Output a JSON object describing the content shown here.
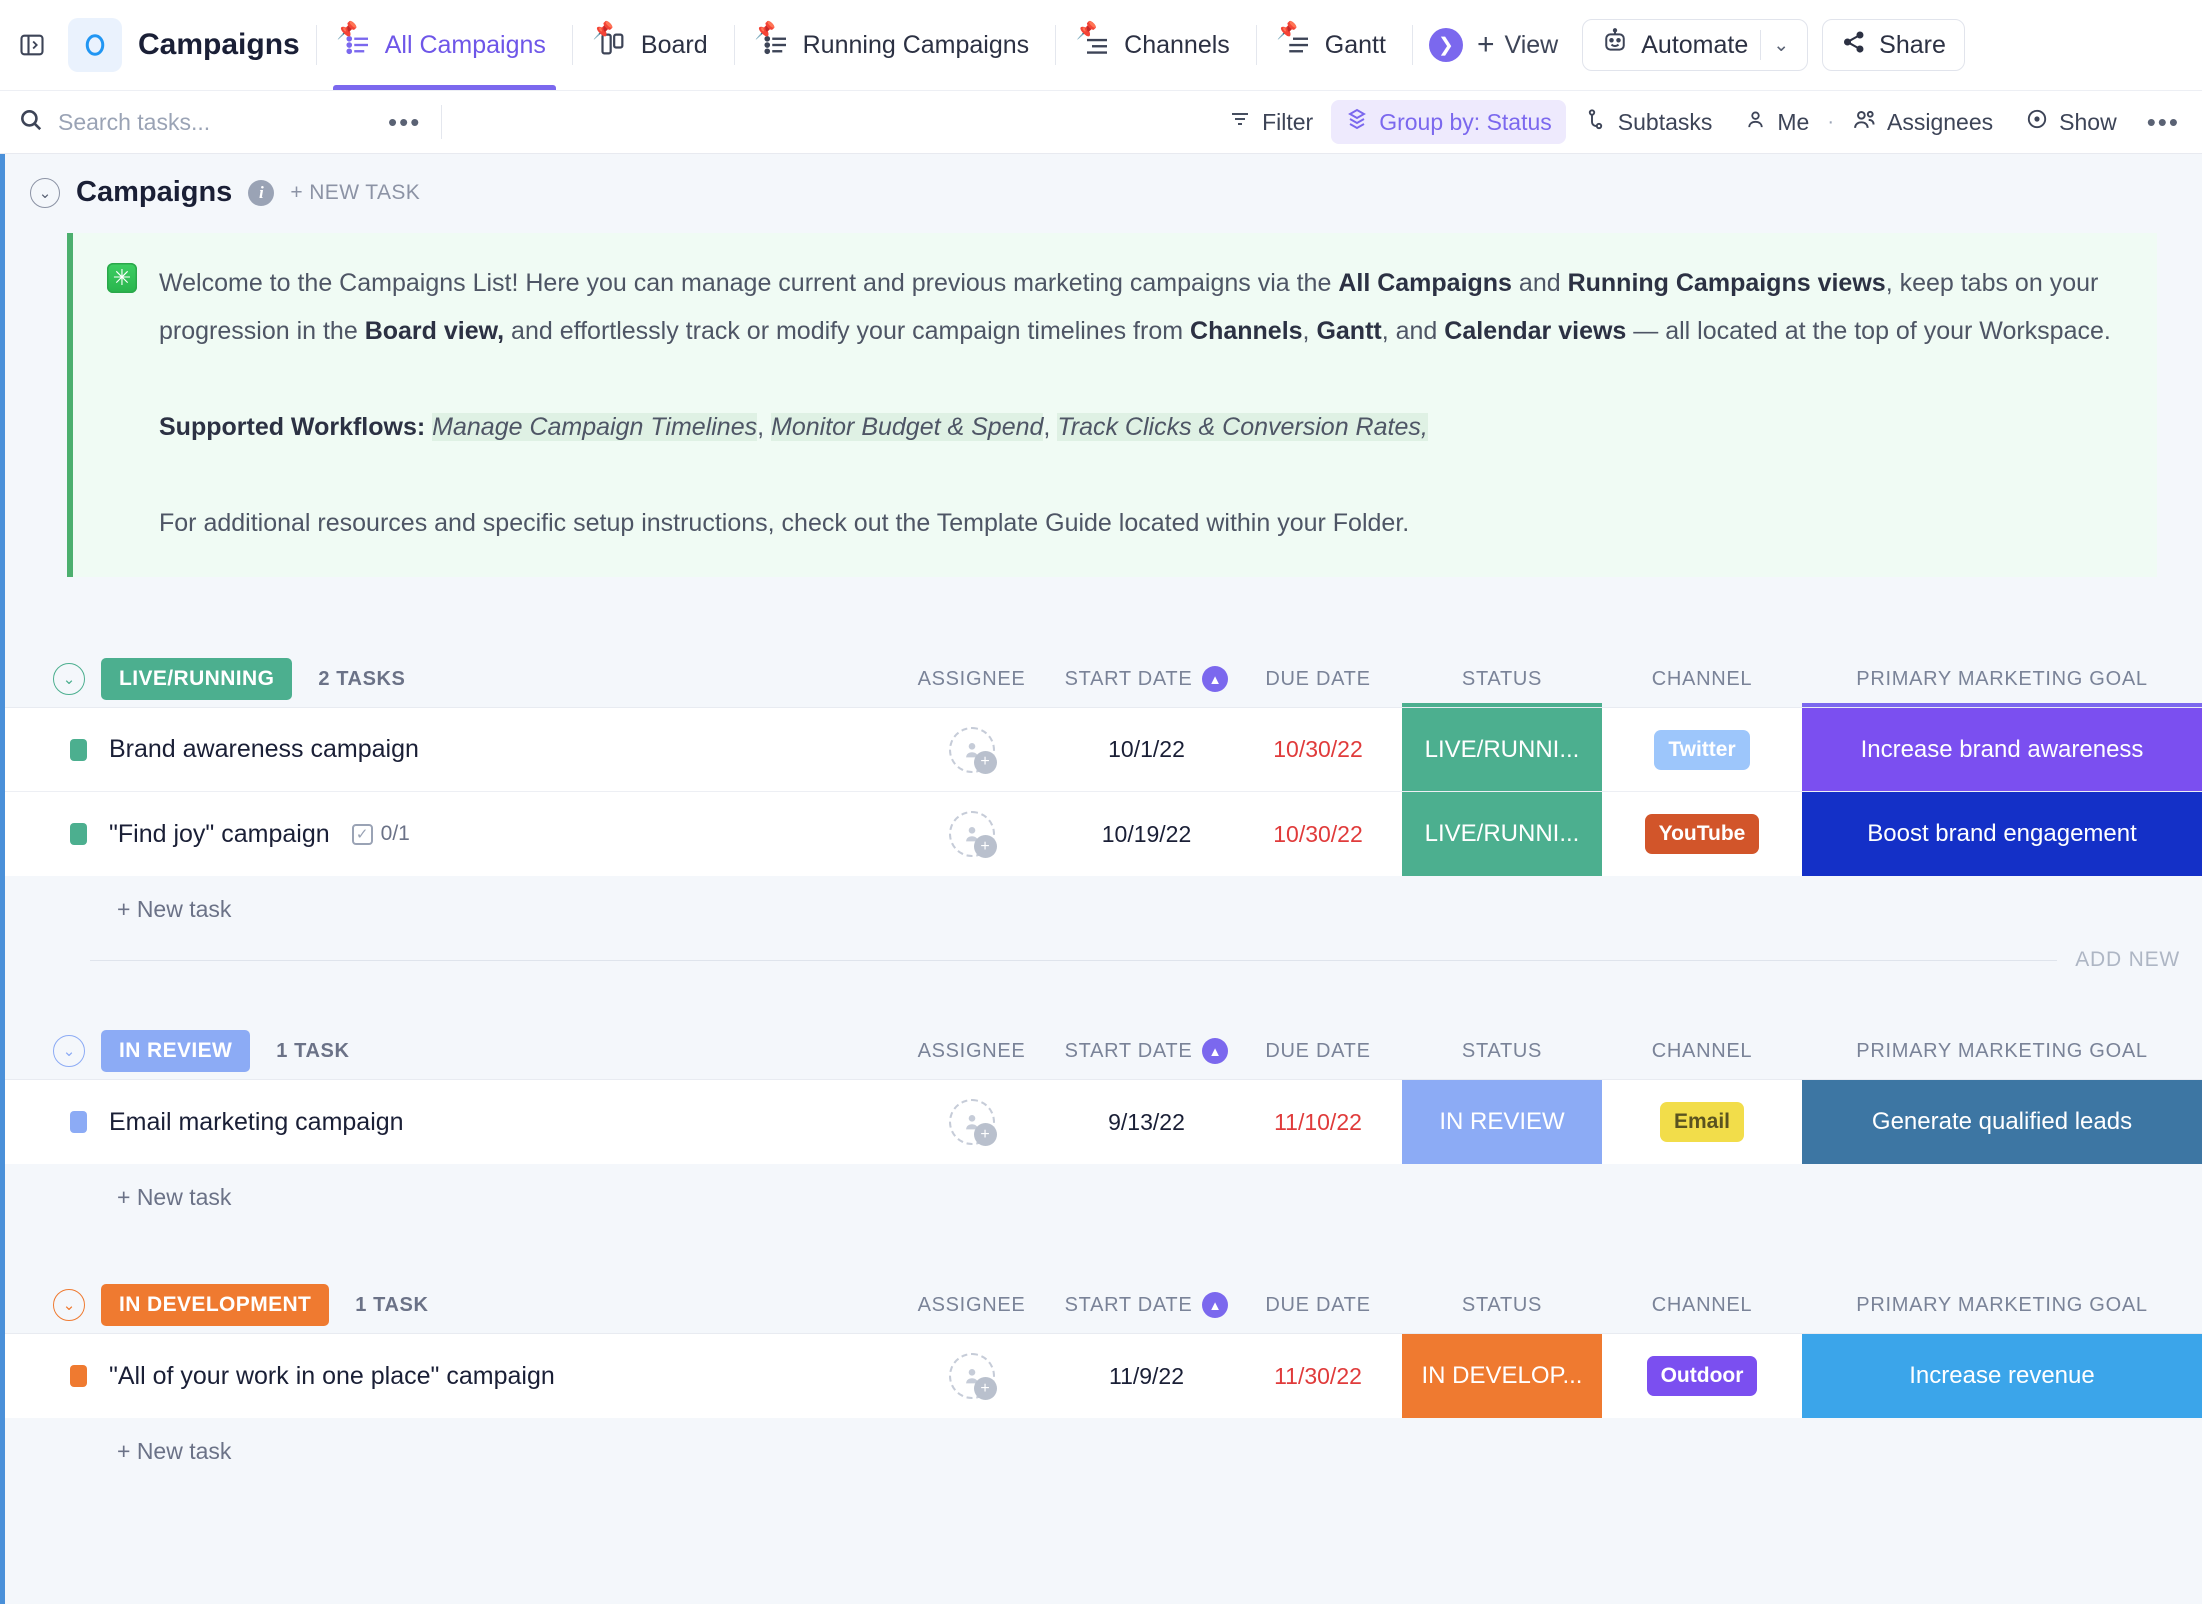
{
  "topbar": {
    "sidebar_toggle_icon": "panel-expand-icon",
    "list_icon": "list-circle-icon",
    "title": "Campaigns",
    "views": [
      {
        "label": "All Campaigns",
        "icon": "list-view-icon",
        "active": true,
        "pinned": true
      },
      {
        "label": "Board",
        "icon": "board-view-icon",
        "active": false,
        "pinned": true
      },
      {
        "label": "Running Campaigns",
        "icon": "list-view-icon",
        "active": false,
        "pinned": true
      },
      {
        "label": "Channels",
        "icon": "channels-view-icon",
        "active": false,
        "pinned": true
      },
      {
        "label": "Gantt",
        "icon": "gantt-view-icon",
        "active": false,
        "pinned": true
      }
    ],
    "more_views_icon": "chevron-right-circle-icon",
    "add_view_label": "View",
    "automate_label": "Automate",
    "automate_icon": "robot-icon",
    "automate_caret_icon": "chevron-down-icon",
    "share_label": "Share",
    "share_icon": "share-icon"
  },
  "toolbar": {
    "search_placeholder": "Search tasks...",
    "search_value": "",
    "search_icon": "search-icon",
    "more_icon": "ellipsis-icon",
    "buttons": [
      {
        "label": "Filter",
        "icon": "filter-icon",
        "active": false
      },
      {
        "label": "Group by: Status",
        "icon": "group-by-icon",
        "active": true
      },
      {
        "label": "Subtasks",
        "icon": "subtasks-icon",
        "active": false
      },
      {
        "label": "Me",
        "icon": "person-icon",
        "active": false
      },
      {
        "label": "Assignees",
        "icon": "people-icon",
        "active": false
      },
      {
        "label": "Show",
        "icon": "eye-icon",
        "active": false
      }
    ],
    "overflow_icon": "ellipsis-icon"
  },
  "list_header": {
    "collapse_icon": "chevron-down-circle-icon",
    "title": "Campaigns",
    "info_icon": "info-icon",
    "new_task_label": "+ NEW TASK"
  },
  "banner": {
    "icon": "asterisk-green-icon",
    "line1_a": "Welcome to the Campaigns List! Here you can manage current and previous marketing campaigns via the ",
    "line1_b": "All Campaigns",
    "line1_c": " and ",
    "line1_d": "Running Campaigns views",
    "line1_e": ", keep tabs on your progression in the ",
    "line1_f": "Board view,",
    "line1_g": " and effortlessly track or modify your campaign timelines from ",
    "line1_h": "Channels",
    "line1_i": ", ",
    "line1_j": "Gantt",
    "line1_k": ", and ",
    "line1_l": "Calendar views",
    "line1_m": " — all located at the top of your Workspace.",
    "workflows_label": "Supported Workflows: ",
    "workflow_1": "Manage Campaign Timelines",
    "workflow_2": "Monitor Budget & Spend",
    "workflow_3": "Track Clicks & Conversion Rates,",
    "sep": ", ",
    "footer": "For additional resources and specific setup instructions, check out the Template Guide located within your Folder."
  },
  "columns": {
    "assignee": "ASSIGNEE",
    "start_date": "START DATE",
    "due_date": "DUE DATE",
    "status": "STATUS",
    "channel": "CHANNEL",
    "goal": "PRIMARY MARKETING GOAL",
    "sort_icon": "sort-ascending-icon"
  },
  "add_new_label": "ADD NEW",
  "new_task_label": "+ New task",
  "groups": [
    {
      "status_label": "LIVE/RUNNING",
      "status_color": "#4caf8f",
      "ring_color": "#4caf8f",
      "count_label": "2 TASKS",
      "tasks": [
        {
          "title": "Brand awareness campaign",
          "dot_color": "#4caf8f",
          "subtask": null,
          "assignee": "",
          "start_date": "10/1/22",
          "due_date": "10/30/22",
          "status_text": "LIVE/RUNNI...",
          "status_bg": "#4caf8f",
          "channel": "Twitter",
          "channel_bg": "#9dc6fb",
          "channel_fg": "#ffffff",
          "goal": "Increase brand awareness",
          "goal_bg": "#7b4ff0"
        },
        {
          "title": "\"Find joy\" campaign",
          "dot_color": "#4caf8f",
          "subtask": "0/1",
          "assignee": "",
          "start_date": "10/19/22",
          "due_date": "10/30/22",
          "status_text": "LIVE/RUNNI...",
          "status_bg": "#4caf8f",
          "channel": "YouTube",
          "channel_bg": "#d2552a",
          "channel_fg": "#ffffff",
          "goal": "Boost brand engagement",
          "goal_bg": "#1430c7"
        }
      ]
    },
    {
      "status_label": "IN REVIEW",
      "status_color": "#8cabf5",
      "ring_color": "#8cabf5",
      "count_label": "1 TASK",
      "tasks": [
        {
          "title": "Email marketing campaign",
          "dot_color": "#8cabf5",
          "subtask": null,
          "assignee": "",
          "start_date": "9/13/22",
          "due_date": "11/10/22",
          "status_text": "IN REVIEW",
          "status_bg": "#8cabf5",
          "channel": "Email",
          "channel_bg": "#f2dd4a",
          "channel_fg": "#5a5320",
          "goal": "Generate qualified leads",
          "goal_bg": "#3d76a3"
        }
      ]
    },
    {
      "status_label": "IN DEVELOPMENT",
      "status_color": "#ef7a30",
      "ring_color": "#ef7a30",
      "count_label": "1 TASK",
      "tasks": [
        {
          "title": "\"All of your work in one place\" campaign",
          "dot_color": "#ef7a30",
          "subtask": null,
          "assignee": "",
          "start_date": "11/9/22",
          "due_date": "11/30/22",
          "status_text": "IN DEVELOP...",
          "status_bg": "#ef7a30",
          "channel": "Outdoor",
          "channel_bg": "#7b4ff0",
          "channel_fg": "#ffffff",
          "goal": "Increase revenue",
          "goal_bg": "#3ba5ea"
        }
      ]
    }
  ]
}
